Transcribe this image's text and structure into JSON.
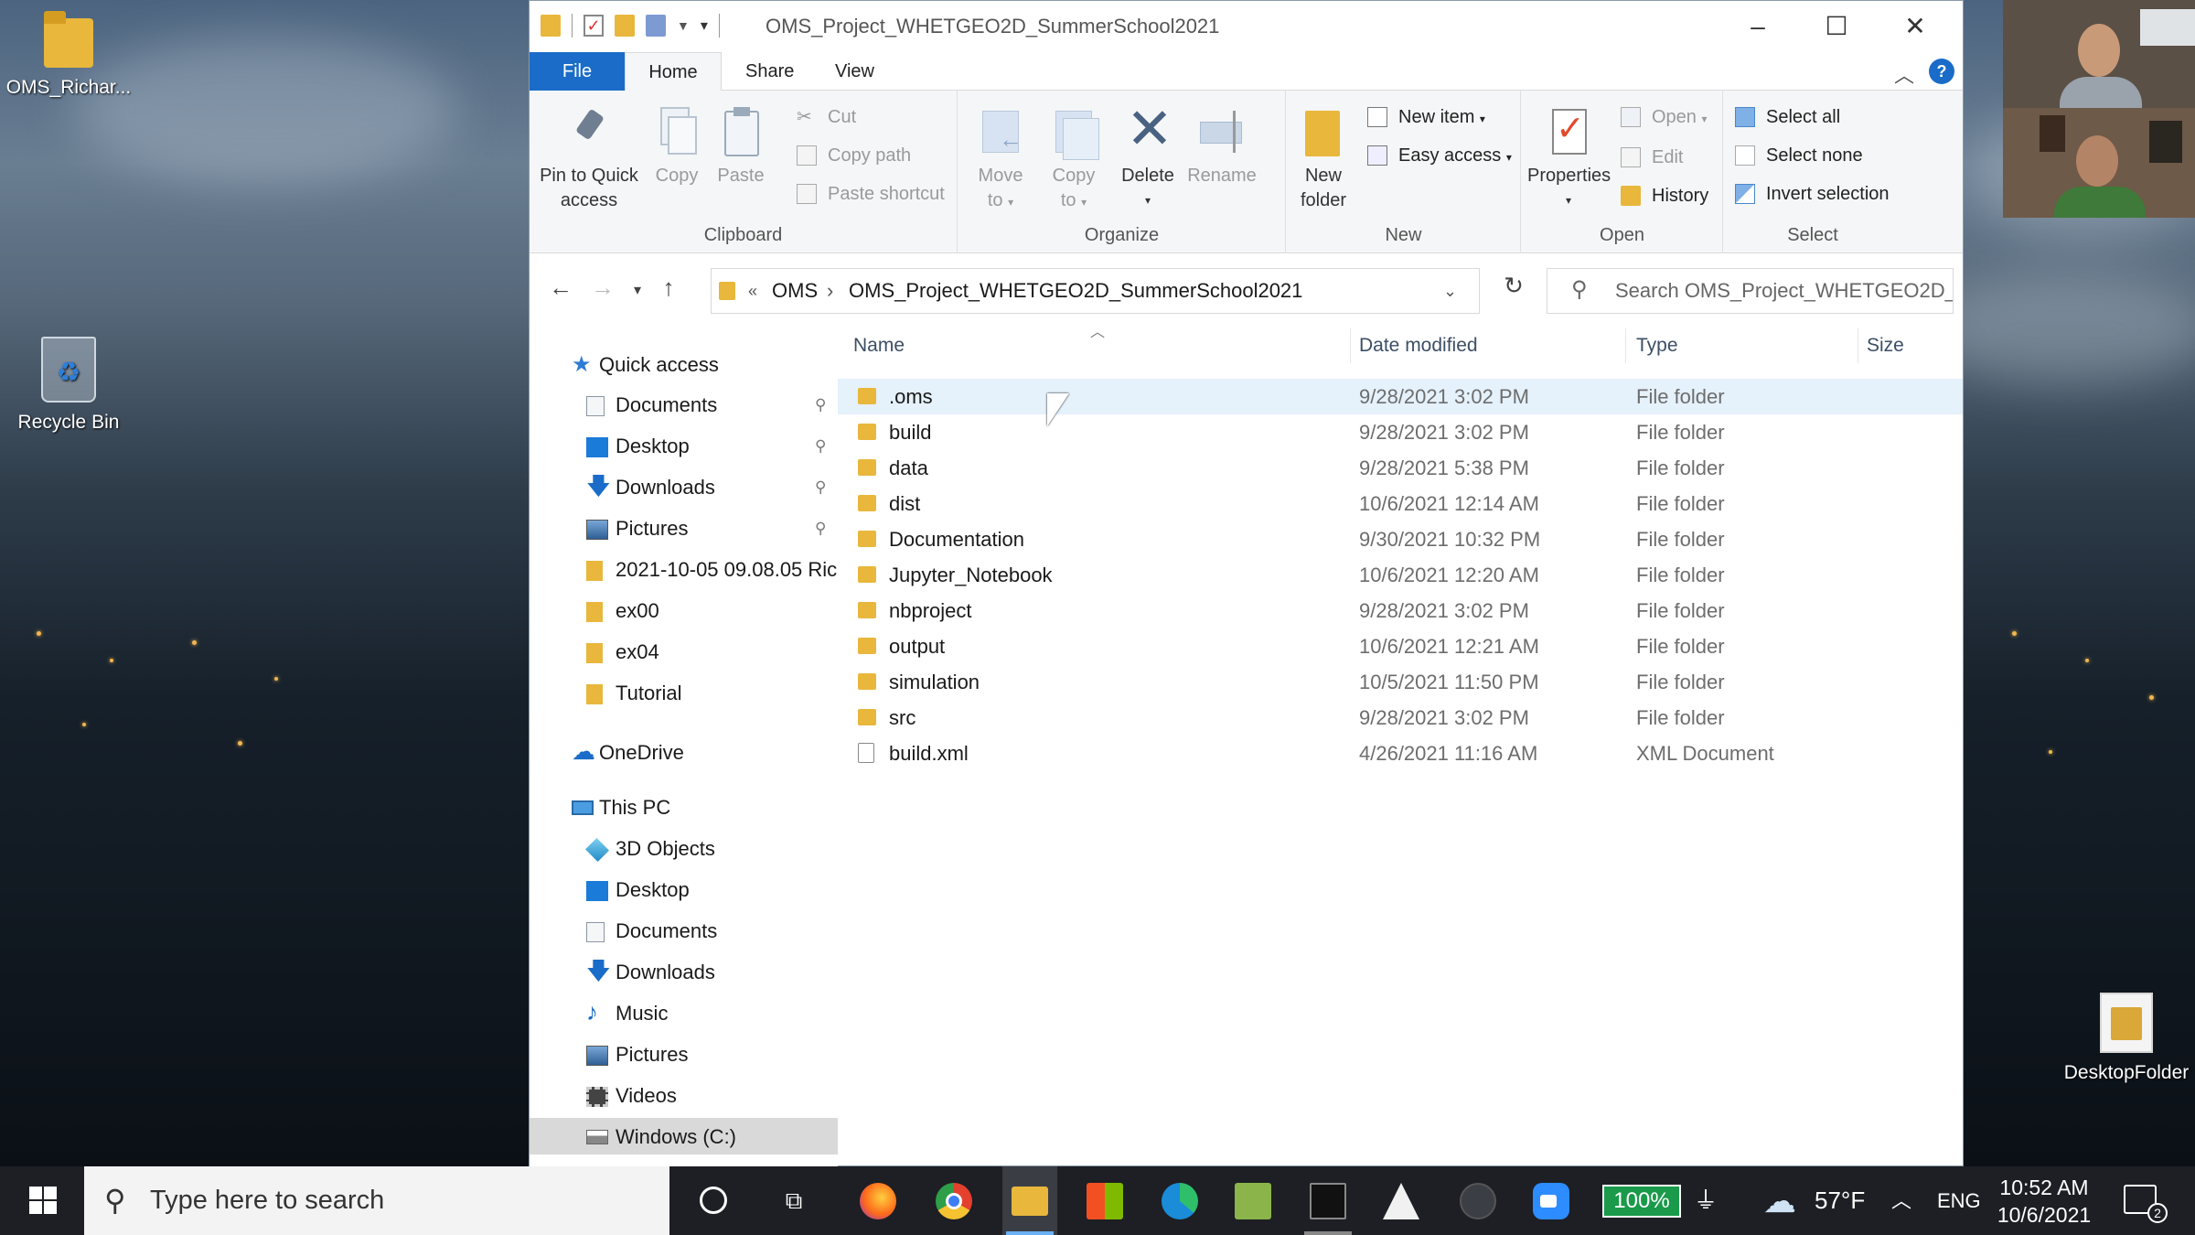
{
  "desktop": {
    "icons": [
      {
        "label": "OMS_Richar...",
        "icon": "folder-icon"
      },
      {
        "label": "Recycle Bin",
        "icon": "recycle-bin-icon"
      },
      {
        "label": "DesktopFolder",
        "icon": "document-folder-icon"
      }
    ]
  },
  "explorer": {
    "title": "OMS_Project_WHETGEO2D_SummerSchool2021",
    "ribbon_tabs": [
      "File",
      "Home",
      "Share",
      "View"
    ],
    "active_tab": "Home",
    "clipboard": {
      "label": "Clipboard",
      "pin": "Pin to Quick",
      "pin2": "access",
      "copy": "Copy",
      "paste": "Paste",
      "cut": "Cut",
      "copy_path": "Copy path",
      "paste_shortcut": "Paste shortcut"
    },
    "organize": {
      "label": "Organize",
      "move": "Move",
      "move2": "to",
      "copyto": "Copy",
      "copyto2": "to",
      "delete": "Delete",
      "rename": "Rename"
    },
    "new": {
      "label": "New",
      "new_folder": "New",
      "new_folder2": "folder",
      "new_item": "New item",
      "easy_access": "Easy access"
    },
    "open": {
      "label": "Open",
      "properties": "Properties",
      "open": "Open",
      "edit": "Edit",
      "history": "History"
    },
    "select": {
      "label": "Select",
      "select_all": "Select all",
      "select_none": "Select none",
      "invert": "Invert selection"
    },
    "address": {
      "prefix": "«",
      "crumbs": [
        "OMS",
        "OMS_Project_WHETGEO2D_SummerSchool2021"
      ],
      "separator": "›"
    },
    "search": {
      "placeholder": "Search OMS_Project_WHETGEO2D_..."
    },
    "nav": {
      "quick_access": "Quick access",
      "quick_items": [
        "Documents",
        "Desktop",
        "Downloads",
        "Pictures",
        "2021-10-05 09.08.05 Ric",
        "ex00",
        "ex04",
        "Tutorial"
      ],
      "onedrive": "OneDrive",
      "this_pc": "This PC",
      "pc_items": [
        "3D Objects",
        "Desktop",
        "Documents",
        "Downloads",
        "Music",
        "Pictures",
        "Videos",
        "Windows (C:)"
      ]
    },
    "columns": {
      "name": "Name",
      "date": "Date modified",
      "type": "Type",
      "size": "Size"
    },
    "files": [
      {
        "name": ".oms",
        "date": "9/28/2021 3:02 PM",
        "type": "File folder"
      },
      {
        "name": "build",
        "date": "9/28/2021 3:02 PM",
        "type": "File folder"
      },
      {
        "name": "data",
        "date": "9/28/2021 5:38 PM",
        "type": "File folder"
      },
      {
        "name": "dist",
        "date": "10/6/2021 12:14 AM",
        "type": "File folder"
      },
      {
        "name": "Documentation",
        "date": "9/30/2021 10:32 PM",
        "type": "File folder"
      },
      {
        "name": "Jupyter_Notebook",
        "date": "10/6/2021 12:20 AM",
        "type": "File folder"
      },
      {
        "name": "nbproject",
        "date": "9/28/2021 3:02 PM",
        "type": "File folder"
      },
      {
        "name": "output",
        "date": "10/6/2021 12:21 AM",
        "type": "File folder"
      },
      {
        "name": "simulation",
        "date": "10/5/2021 11:50 PM",
        "type": "File folder"
      },
      {
        "name": "src",
        "date": "9/28/2021 3:02 PM",
        "type": "File folder"
      },
      {
        "name": "build.xml",
        "date": "4/26/2021 11:16 AM",
        "type": "XML Document"
      }
    ]
  },
  "taskbar": {
    "search_placeholder": "Type here to search",
    "battery": "100%",
    "weather": "57°F",
    "language": "ENG",
    "time": "10:52 AM",
    "date": "10/6/2021",
    "notifications": "2"
  },
  "colors": {
    "accent": "#1a6cc8",
    "folder": "#e8b73c",
    "selection": "#e5f1fb"
  }
}
